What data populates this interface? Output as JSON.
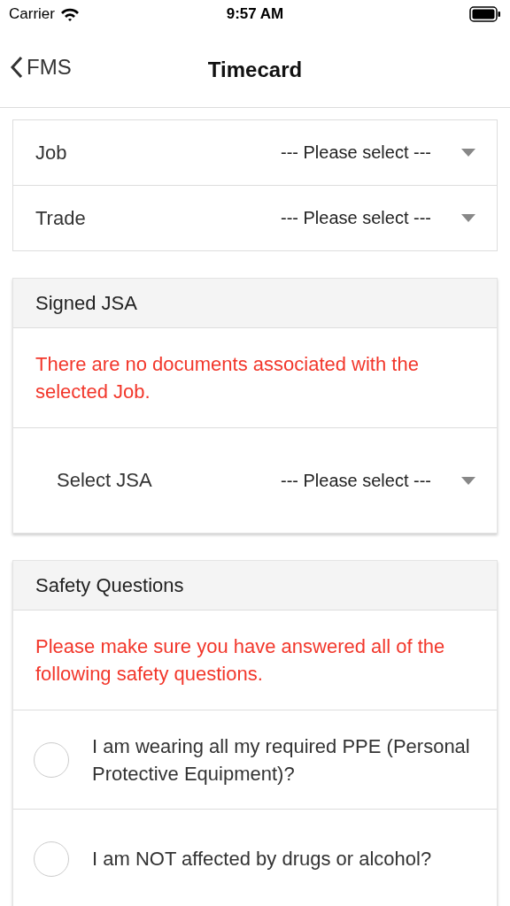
{
  "status_bar": {
    "carrier": "Carrier",
    "time": "9:57 AM"
  },
  "nav": {
    "back": "FMS",
    "title": "Timecard"
  },
  "selects": [
    {
      "label": "Job",
      "value": "--- Please select ---"
    },
    {
      "label": "Trade",
      "value": "--- Please select ---"
    }
  ],
  "jsa": {
    "title": "Signed JSA",
    "message": "There are no documents associated with the selected Job.",
    "select": {
      "label": "Select JSA",
      "value": "--- Please select ---"
    }
  },
  "safety": {
    "title": "Safety Questions",
    "message": "Please make sure you have answered all of the following safety questions.",
    "questions": [
      {
        "text": "I am wearing all my required PPE (Personal Protective Equipment)?",
        "checked": false
      },
      {
        "text": "I am NOT affected by drugs or alcohol?",
        "checked": false
      }
    ]
  }
}
